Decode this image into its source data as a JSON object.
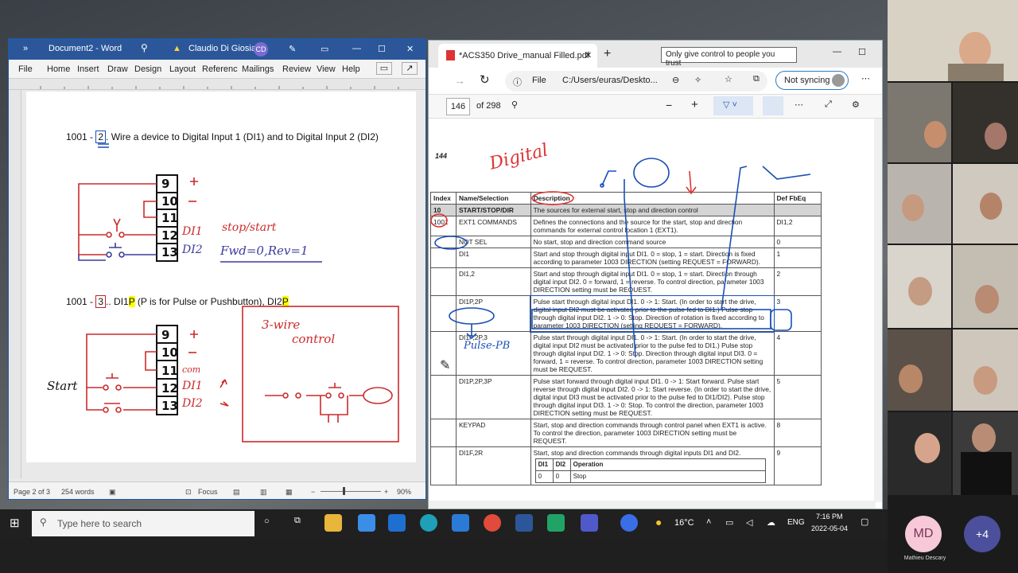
{
  "word": {
    "title": "Document2 - Word",
    "user_name": "Claudio Di Giosia",
    "user_initials": "CD",
    "menu": [
      "File",
      "Home",
      "Insert",
      "Draw",
      "Design",
      "Layout",
      "Referenc",
      "Mailings",
      "Review",
      "View",
      "Help"
    ],
    "line1_prefix": "1001 - ",
    "line1_value": "2",
    "line1_text": ". Wire a device to Digital Input 1 (DI1) and to Digital Input 2 (DI2)",
    "line2_prefix": "1001 - ",
    "line2_value": "3",
    "line2_text_a": ".. DI1",
    "line2_hl1": "P",
    "line2_text_b": " (P is for Pulse or Pushbutton), DI2",
    "line2_hl2": "P",
    "terminals_1": [
      "9",
      "10",
      "11",
      "12",
      "13"
    ],
    "terminals_2": [
      "9",
      "10",
      "11",
      "12",
      "13"
    ],
    "hw_di1_1": "DI1",
    "hw_stopstart": "stop/start",
    "hw_di2_1": "DI2",
    "hw_fwd": "Fwd=0,Rev=1",
    "hw_com": "com",
    "hw_di1_2": "DI1",
    "hw_di2_2": "DI2",
    "hw_start": "Start",
    "hw_3wire_a": "3-wire",
    "hw_3wire_b": "control",
    "status_page": "Page 2 of 3",
    "status_words": "254 words",
    "status_focus": "Focus",
    "status_zoom": "90%"
  },
  "edge": {
    "tab_title": "*ACS350 Drive_manual Filled.pdf",
    "url_label": "File",
    "url": "C:/Users/euras/Deskto...",
    "sync_label": "Not syncing",
    "page_current": "146",
    "page_total": "of 298",
    "page_number": "144",
    "hw_digital": "Digital",
    "hw_pulse": "Pulse-PB",
    "table": {
      "headers": [
        "Index",
        "Name/Selection",
        "Description",
        "Def FbEq"
      ],
      "group": {
        "index": "10",
        "name": "START/STOP/DIR",
        "desc": "The sources for external start, stop and direction control"
      },
      "rows": [
        {
          "index": "1001",
          "name": "EXT1 COMMANDS",
          "desc": "Defines the connections and the source for the start, stop and direction commands for external control location 1 (EXT1).",
          "def": "DI1,2"
        },
        {
          "index": "",
          "name": "NOT SEL",
          "desc": "No start, stop and direction command source",
          "def": "0"
        },
        {
          "index": "",
          "name": "DI1",
          "desc": "Start and stop through digital input DI1. 0 = stop, 1 = start. Direction is fixed according to parameter 1003 DIRECTION (setting REQUEST = FORWARD).",
          "def": "1"
        },
        {
          "index": "",
          "name": "DI1,2",
          "desc": "Start and stop through digital input DI1. 0 = stop, 1 = start. Direction through digital input DI2. 0 = forward, 1 = reverse. To control direction, parameter 1003 DIRECTION setting must be REQUEST.",
          "def": "2"
        },
        {
          "index": "",
          "name": "DI1P,2P",
          "desc": "Pulse start through digital input DI1. 0 -> 1: Start. (In order to start the drive, digital input DI2 must be activated prior to the pulse fed to DI1.) Pulse stop through digital input DI2. 1 -> 0: Stop. Direction of rotation is fixed according to parameter 1003 DIRECTION (setting REQUEST = FORWARD).",
          "def": "3"
        },
        {
          "index": "",
          "name": "DI1P,2P,3",
          "desc": "Pulse start through digital input DI1. 0 -> 1: Start. (In order to start the drive, digital input DI2 must be activated prior to the pulse fed to DI1.) Pulse stop through digital input DI2. 1 -> 0: Stop. Direction through digital input DI3. 0 = forward, 1 = reverse. To control direction, parameter 1003 DIRECTION setting must be REQUEST.",
          "def": "4"
        },
        {
          "index": "",
          "name": "DI1P,2P,3P",
          "desc": "Pulse start forward through digital input DI1. 0 -> 1: Start forward. Pulse start reverse through digital input DI2. 0 -> 1: Start reverse. (In order to start the drive, digital input DI3 must be activated prior to the pulse fed to DI1/DI2). Pulse stop through digital input DI3. 1 -> 0: Stop. To control the direction, parameter 1003 DIRECTION setting must be REQUEST.",
          "def": "5"
        },
        {
          "index": "",
          "name": "KEYPAD",
          "desc": "Start, stop and direction commands through control panel when EXT1 is active. To control the direction, parameter 1003 DIRECTION setting must be REQUEST.",
          "def": "8"
        },
        {
          "index": "",
          "name": "DI1F,2R",
          "desc": "Start, stop and direction commands through digital inputs DI1 and DI2.",
          "def": "9"
        }
      ],
      "subtable_headers": [
        "DI1",
        "DI2",
        "Operation"
      ],
      "subtable_row": [
        "0",
        "0",
        "Stop"
      ]
    }
  },
  "tooltip": "Only give control to people you trust",
  "taskbar": {
    "search_placeholder": "Type here to search",
    "weather": "16°C",
    "lang": "ENG",
    "time": "7:16 PM",
    "date": "2022-05-04"
  },
  "video": {
    "md_initials": "MD",
    "md_name": "Mathieu Descary",
    "more_count": "+4"
  }
}
